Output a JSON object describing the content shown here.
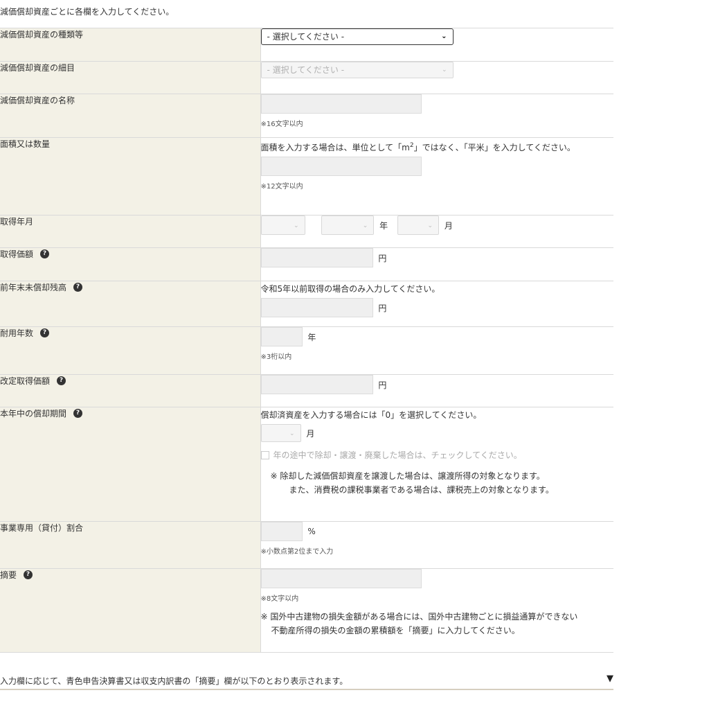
{
  "intro": "減価償却資産ごとに各欄を入力してください。",
  "rows": {
    "type": {
      "label": "減価償却資産の種類等",
      "select": "- 選択してください -"
    },
    "detail": {
      "label": "減価償却資産の細目",
      "select": "- 選択してください -"
    },
    "name": {
      "label": "減価償却資産の名称",
      "note": "※16文字以内"
    },
    "area": {
      "label": "面積又は数量",
      "desc_pre": "面積を入力する場合は、単位として「m",
      "desc_sup": "2",
      "desc_post": "」ではなく、「平米」を入力してください。",
      "note": "※12文字以内"
    },
    "acq_date": {
      "label": "取得年月",
      "year_unit": "年",
      "month_unit": "月"
    },
    "acq_price": {
      "label": "取得価額",
      "unit": "円"
    },
    "prev_balance": {
      "label": "前年末未償却残高",
      "desc": "令和5年以前取得の場合のみ入力してください。",
      "unit": "円"
    },
    "life": {
      "label": "耐用年数",
      "unit": "年",
      "note": "※3桁以内"
    },
    "revised_price": {
      "label": "改定取得価額",
      "unit": "円"
    },
    "period": {
      "label": "本年中の償却期間",
      "desc": "償却済資産を入力する場合には「0」を選択してください。",
      "unit": "月",
      "checkbox_label": "年の途中で除却・譲渡・廃棄した場合は、チェックしてください。",
      "remark_line1": "※ 除却した減価償却資産を譲渡した場合は、譲渡所得の対象となります。",
      "remark_line2": "また、消費税の課税事業者である場合は、課税売上の対象となります。"
    },
    "business_ratio": {
      "label": "事業専用（貸付）割合",
      "unit": "%",
      "note": "※小数点第2位まで入力"
    },
    "summary": {
      "label": "摘要",
      "note": "※8文字以内",
      "remark_line1": "※ 国外中古建物の損失金額がある場合には、国外中古建物ごとに損益通算ができない",
      "remark_line2": "不動産所得の損失の金額の累積額を「摘要」に入力してください。"
    }
  },
  "help_icon": "?",
  "bottom": {
    "text": "入力欄に応じて、青色申告決算書又は収支内訳書の「摘要」欄が以下のとおり表示されます。",
    "toggle_icon": "▼"
  }
}
